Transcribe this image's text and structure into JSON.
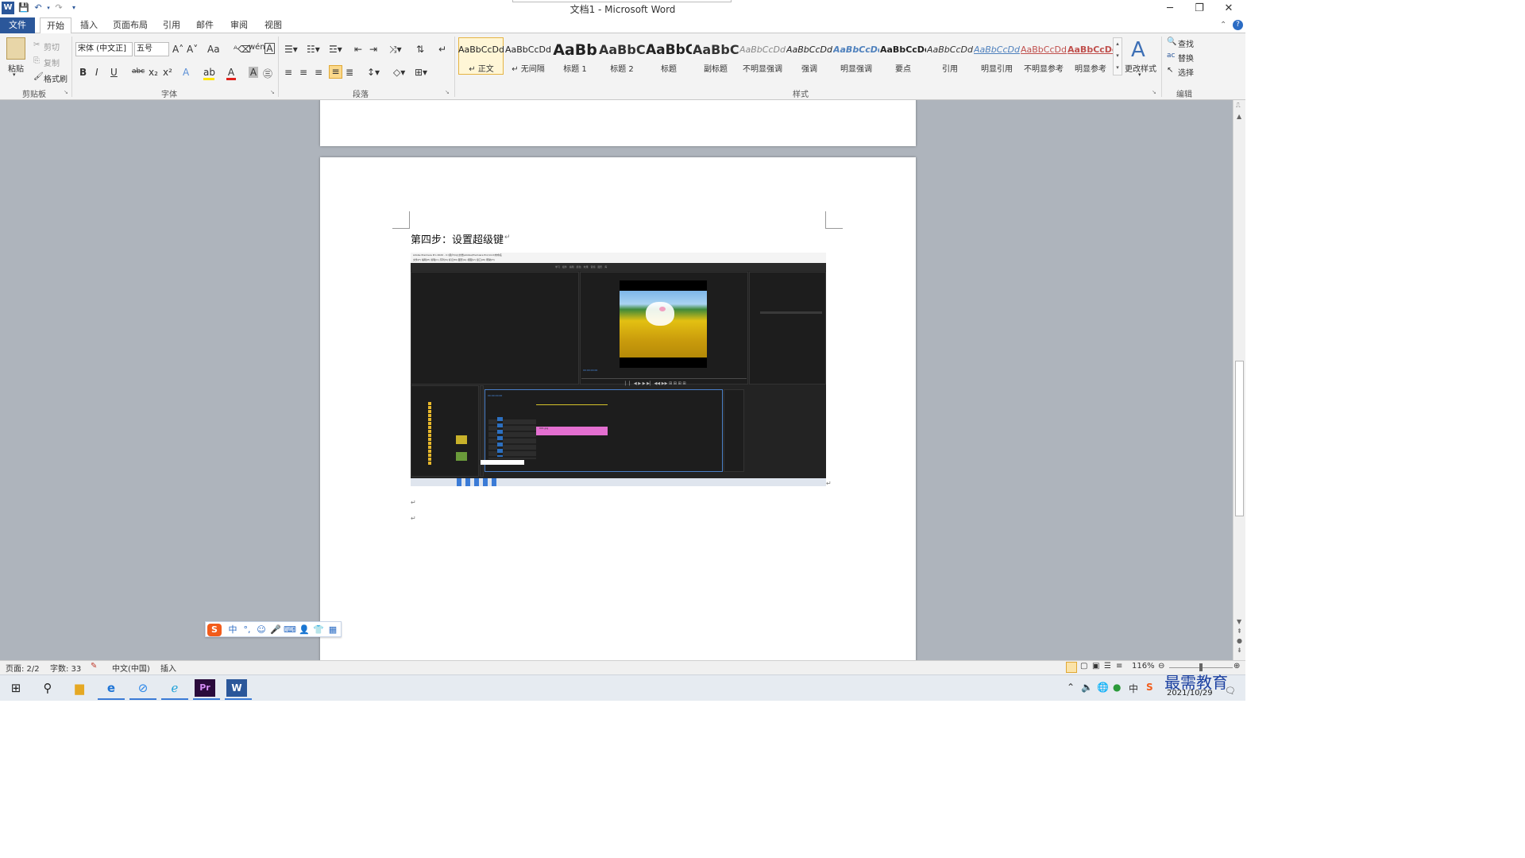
{
  "window": {
    "title": "文档1 - Microsoft Word",
    "app_icon": "word-icon",
    "controls": {
      "minimize": "─",
      "restore": "❐",
      "close": "✕"
    }
  },
  "qat": {
    "save_icon": "save-icon",
    "undo_icon": "undo-icon",
    "redo_icon": "redo-icon"
  },
  "tabs": [
    "文件",
    "开始",
    "插入",
    "页面布局",
    "引用",
    "邮件",
    "审阅",
    "视图"
  ],
  "ribbon": {
    "clipboard": {
      "paste": "粘贴",
      "cut": "剪切",
      "copy": "复制",
      "format_painter": "格式刷",
      "group": "剪贴板"
    },
    "font": {
      "family": "宋体 (中文正]",
      "size": "五号",
      "group": "字体",
      "bold": "B",
      "italic": "I",
      "underline": "U",
      "strike": "abc",
      "sub": "x₂",
      "sup": "x²",
      "grow": "A˄",
      "shrink": "A˅",
      "case": "Aa"
    },
    "paragraph": {
      "group": "段落"
    },
    "styles": {
      "group": "样式",
      "items": [
        {
          "preview": "AaBbCcDd",
          "name": "↵ 正文"
        },
        {
          "preview": "AaBbCcDd",
          "name": "↵ 无间隔"
        },
        {
          "preview": "AaBb",
          "name": "标题 1"
        },
        {
          "preview": "AaBbC",
          "name": "标题 2"
        },
        {
          "preview": "AaBbC",
          "name": "标题"
        },
        {
          "preview": "AaBbC",
          "name": "副标题"
        },
        {
          "preview": "AaBbCcDd",
          "name": "不明显强调"
        },
        {
          "preview": "AaBbCcDd",
          "name": "强调"
        },
        {
          "preview": "AaBbCcDd",
          "name": "明显强调"
        },
        {
          "preview": "AaBbCcDd",
          "name": "要点"
        },
        {
          "preview": "AaBbCcDd",
          "name": "引用"
        },
        {
          "preview": "AaBbCcDd",
          "name": "明显引用"
        },
        {
          "preview": "AaBbCcDd",
          "name": "不明显参考"
        },
        {
          "preview": "AaBbCcDd",
          "name": "明显参考"
        }
      ],
      "change": "更改样式"
    },
    "editing": {
      "find": "查找",
      "replace": "替换",
      "select": "选择",
      "group": "编辑"
    }
  },
  "document": {
    "heading": "第四步：设置超级键",
    "paragraph_mark": "↵",
    "pr_titlebar": "Adobe Premiere Pro 2020 - C:\\用户\\lily\\文档\\Adobe\\Premiere Pro\\14.0\\未命名",
    "pr_menu": [
      "文件(F)",
      "编辑(E)",
      "剪辑(C)",
      "序列(S)",
      "标记(M)",
      "图形(G)",
      "视图(V)",
      "窗口(W)",
      "帮助(H)"
    ],
    "pr_workspaces": [
      "学习",
      "组件",
      "编辑",
      "颜色",
      "效果",
      "音频",
      "图形",
      "库"
    ],
    "pr_timecode": "00:00:00:00",
    "pr_clip": "001.jpg"
  },
  "status": {
    "page": "页面: 2/2",
    "words": "字数: 33",
    "lang": "中文(中国)",
    "mode": "插入",
    "zoom": "116%"
  },
  "taskbar": {
    "apps": [
      "start-icon",
      "search-icon",
      "folder-icon",
      "edge-icon",
      "browser-icon",
      "ie-icon",
      "premiere-icon",
      "word-icon"
    ],
    "date": "2021/10/29",
    "watermark": "最需教育"
  },
  "ime": {
    "logo": "S",
    "mode": "中"
  }
}
